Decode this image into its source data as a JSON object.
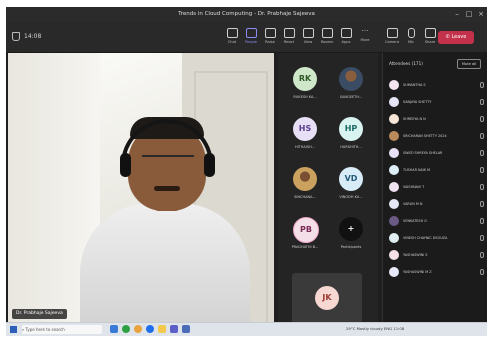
{
  "window": {
    "title": "Trends in Cloud Computing - Dr. Prabhaje Sajeeva"
  },
  "meeting": {
    "timer": "14:08"
  },
  "toolbar": {
    "buttons": [
      {
        "label": "Chat"
      },
      {
        "label": "People"
      },
      {
        "label": "Raise"
      },
      {
        "label": "React"
      },
      {
        "label": "View"
      },
      {
        "label": "Rooms"
      },
      {
        "label": "Apps"
      },
      {
        "label": "More"
      },
      {
        "label": "Camera"
      },
      {
        "label": "Mic"
      },
      {
        "label": "Share"
      }
    ],
    "leave_label": "Leave"
  },
  "main_video": {
    "name_tag": "Dr. Prabhaje Sajeeva"
  },
  "tiles": [
    {
      "initials": "RK",
      "name": "RUKESH KA...",
      "avatar_bg": "#cfe7c9",
      "avatar_fg": "#2f5a2a"
    },
    {
      "initials": "",
      "name": "SANGEETH...",
      "avatar_bg": "#415a7a",
      "avatar_fg": "#ffffff"
    },
    {
      "initials": "HS",
      "name": "HITHAISH...",
      "avatar_bg": "#e7dff5",
      "avatar_fg": "#5b3d91"
    },
    {
      "initials": "HP",
      "name": "HARSHITH...",
      "avatar_bg": "#d9f3f0",
      "avatar_fg": "#1f6c63"
    },
    {
      "initials": "",
      "name": "SINCHANA...",
      "avatar_bg": "#caa15e",
      "avatar_fg": "#ffffff"
    },
    {
      "initials": "VD",
      "name": "VINODH KU...",
      "avatar_bg": "#d8ecf7",
      "avatar_fg": "#235b7a"
    },
    {
      "initials": "PB",
      "name": "PRAGHATHI B...",
      "avatar_bg": "#f4dfe9",
      "avatar_fg": "#7a2b55"
    },
    {
      "initials": "+",
      "name": "Participants",
      "avatar_bg": "#111111",
      "avatar_fg": "#ffffff"
    }
  ],
  "self_view": {
    "initials": "JK",
    "avatar_bg": "#f6d7d2",
    "avatar_fg": "#9b3a2f"
  },
  "attendees": {
    "header": "Attendees (171)",
    "mute_all": "Mute all",
    "people": [
      {
        "name": "SUMANTHA S",
        "color": "#f3e2ef"
      },
      {
        "name": "SANJAYA SHETTY",
        "color": "#e4e6f8"
      },
      {
        "name": "SHREEYA N N",
        "color": "#f7e6d7"
      },
      {
        "name": "SRICHARAN SHETTY 2024",
        "color": "#b98a5a"
      },
      {
        "name": "SWATI SHREYA SHELAR",
        "color": "#e7e0f6"
      },
      {
        "name": "TUSHAR NAIK M",
        "color": "#dceef6"
      },
      {
        "name": "VAISHNAVI T",
        "color": "#f0e3f1"
      },
      {
        "name": "VARUN M N",
        "color": "#e5e7f7"
      },
      {
        "name": "VENKATESH G",
        "color": "#6c5a86"
      },
      {
        "name": "VINESH CHAYNIC DSOUZA",
        "color": "#e0eef4"
      },
      {
        "name": "YASHASWINI S",
        "color": "#f5e0e6"
      },
      {
        "name": "YASHASWINI M Z",
        "color": "#e6e9f7"
      }
    ]
  },
  "taskbar": {
    "search_placeholder": "Type here to search",
    "tray_text": "29°C  Mostly cloudy  ENG  11:08"
  }
}
